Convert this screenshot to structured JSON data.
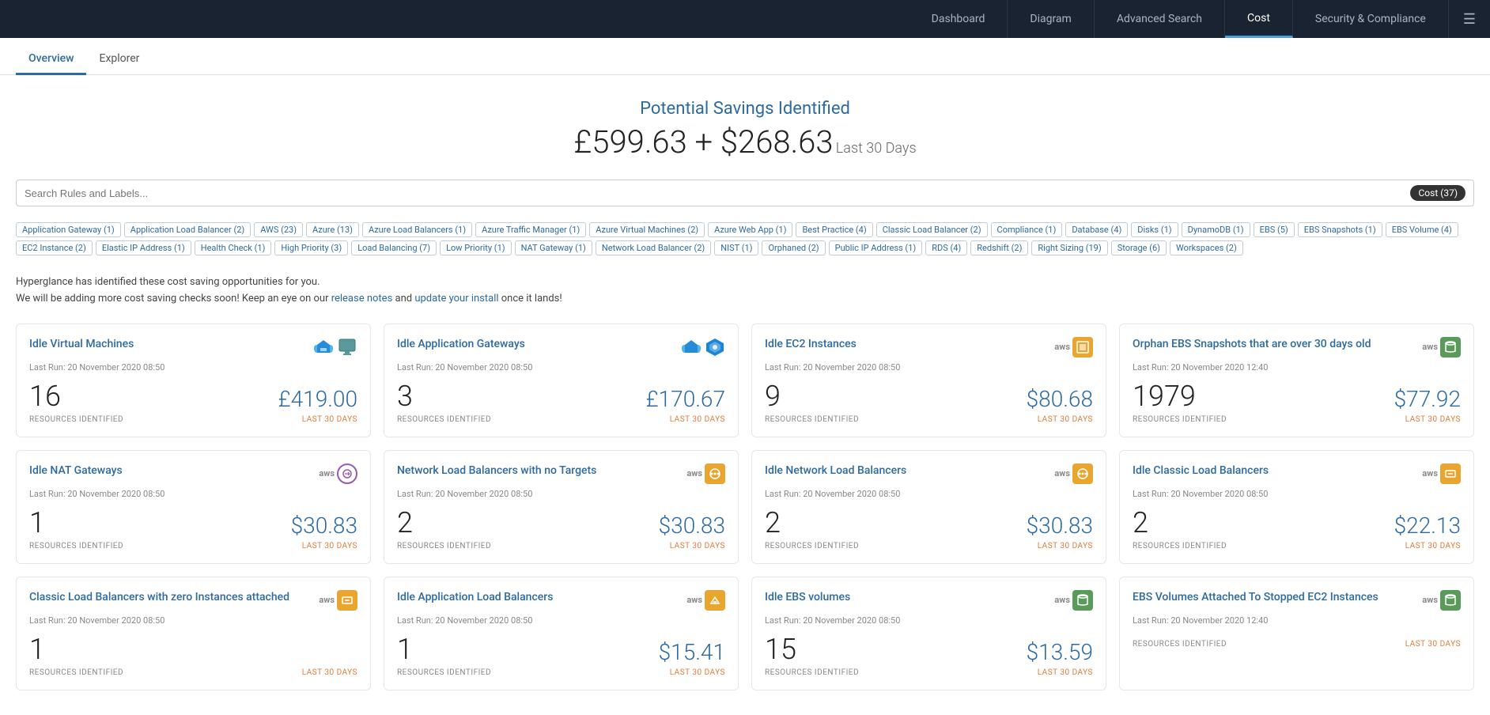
{
  "nav": {
    "items": [
      {
        "id": "dashboard",
        "label": "Dashboard",
        "active": false
      },
      {
        "id": "diagram",
        "label": "Diagram",
        "active": false
      },
      {
        "id": "advanced-search",
        "label": "Advanced Search",
        "active": false
      },
      {
        "id": "cost",
        "label": "Cost",
        "active": true
      },
      {
        "id": "security",
        "label": "Security & Compliance",
        "active": false
      }
    ]
  },
  "sub_tabs": [
    {
      "id": "overview",
      "label": "Overview",
      "active": true
    },
    {
      "id": "explorer",
      "label": "Explorer",
      "active": false
    }
  ],
  "savings": {
    "title": "Potential Savings Identified",
    "amount": "£599.63 + $268.63",
    "period": "Last 30 Days"
  },
  "search": {
    "placeholder": "Search Rules and Labels...",
    "badge_label": "Cost (37)"
  },
  "tags": [
    "Application Gateway (1)",
    "Application Load Balancer (2)",
    "AWS (23)",
    "Azure (13)",
    "Azure Load Balancers (1)",
    "Azure Traffic Manager (1)",
    "Azure Virtual Machines (2)",
    "Azure Web App (1)",
    "Best Practice (4)",
    "Classic Load Balancer (2)",
    "Compliance (1)",
    "Database (4)",
    "Disks (1)",
    "DynamoDB (1)",
    "EBS (5)",
    "EBS Snapshots (1)",
    "EBS Volume (4)",
    "EC2 Instance (2)",
    "Elastic IP Address (1)",
    "Health Check (1)",
    "High Priority (3)",
    "Load Balancing (7)",
    "Low Priority (1)",
    "NAT Gateway (1)",
    "Network Load Balancer (2)",
    "NIST (1)",
    "Orphaned (2)",
    "Public IP Address (1)",
    "RDS (4)",
    "Redshift (2)",
    "Right Sizing (19)",
    "Storage (6)",
    "Workspaces (2)"
  ],
  "info_text_1": "Hyperglance has identified these cost saving opportunities for you.",
  "info_text_2": "We will be adding more cost saving checks soon! Keep an eye on our ",
  "info_link_1": "release notes",
  "info_text_3": " and ",
  "info_link_2": "update your install",
  "info_text_4": " once it lands!",
  "cards": [
    {
      "title": "Idle Virtual Machines",
      "last_run": "Last Run: 20 November 2020 08:50",
      "count": "16",
      "amount": "£419.00",
      "resources_label": "RESOURCES IDENTIFIED",
      "period_label": "LAST 30 DAYS",
      "icon_type": "azure-vm"
    },
    {
      "title": "Idle Application Gateways",
      "last_run": "Last Run: 20 November 2020 08:50",
      "count": "3",
      "amount": "£170.67",
      "resources_label": "RESOURCES IDENTIFIED",
      "period_label": "LAST 30 DAYS",
      "icon_type": "azure-gateway"
    },
    {
      "title": "Idle EC2 Instances",
      "last_run": "Last Run: 20 November 2020 08:50",
      "count": "9",
      "amount": "$80.68",
      "resources_label": "RESOURCES IDENTIFIED",
      "period_label": "LAST 30 DAYS",
      "icon_type": "aws-ec2"
    },
    {
      "title": "Orphan EBS Snapshots that are over 30 days old",
      "last_run": "Last Run: 20 November 2020 12:40",
      "count": "1979",
      "amount": "$77.92",
      "resources_label": "RESOURCES IDENTIFIED",
      "period_label": "LAST 30 DAYS",
      "icon_type": "aws-ebs"
    },
    {
      "title": "Idle NAT Gateways",
      "last_run": "Last Run: 20 November 2020 08:50",
      "count": "1",
      "amount": "$30.83",
      "resources_label": "RESOURCES IDENTIFIED",
      "period_label": "LAST 30 DAYS",
      "icon_type": "aws-nat"
    },
    {
      "title": "Network Load Balancers with no Targets",
      "last_run": "Last Run: 20 November 2020 08:50",
      "count": "2",
      "amount": "$30.83",
      "resources_label": "RESOURCES IDENTIFIED",
      "period_label": "LAST 30 DAYS",
      "icon_type": "aws-nlb"
    },
    {
      "title": "Idle Network Load Balancers",
      "last_run": "Last Run: 20 November 2020 08:50",
      "count": "2",
      "amount": "$30.83",
      "resources_label": "RESOURCES IDENTIFIED",
      "period_label": "LAST 30 DAYS",
      "icon_type": "aws-nlb"
    },
    {
      "title": "Idle Classic Load Balancers",
      "last_run": "Last Run: 20 November 2020 08:50",
      "count": "2",
      "amount": "$22.13",
      "resources_label": "RESOURCES IDENTIFIED",
      "period_label": "LAST 30 DAYS",
      "icon_type": "aws-clb"
    },
    {
      "title": "Classic Load Balancers with zero Instances attached",
      "last_run": "Last Run: 20 November 2020 08:50",
      "count": "1",
      "amount": "",
      "resources_label": "RESOURCES IDENTIFIED",
      "period_label": "LAST 30 DAYS",
      "icon_type": "aws-clb"
    },
    {
      "title": "Idle Application Load Balancers",
      "last_run": "Last Run: 20 November 2020 08:50",
      "count": "1",
      "amount": "$15.41",
      "resources_label": "RESOURCES IDENTIFIED",
      "period_label": "LAST 30 DAYS",
      "icon_type": "aws-alb"
    },
    {
      "title": "Idle EBS volumes",
      "last_run": "Last Run: 20 November 2020 08:50",
      "count": "15",
      "amount": "$13.59",
      "resources_label": "RESOURCES IDENTIFIED",
      "period_label": "LAST 30 DAYS",
      "icon_type": "aws-ebs"
    },
    {
      "title": "EBS Volumes Attached To Stopped EC2 Instances",
      "last_run": "Last Run: 20 November 2020 12:40",
      "count": "",
      "amount": "",
      "resources_label": "RESOURCES IDENTIFIED",
      "period_label": "LAST 30 DAYS",
      "icon_type": "aws-ebs"
    }
  ]
}
